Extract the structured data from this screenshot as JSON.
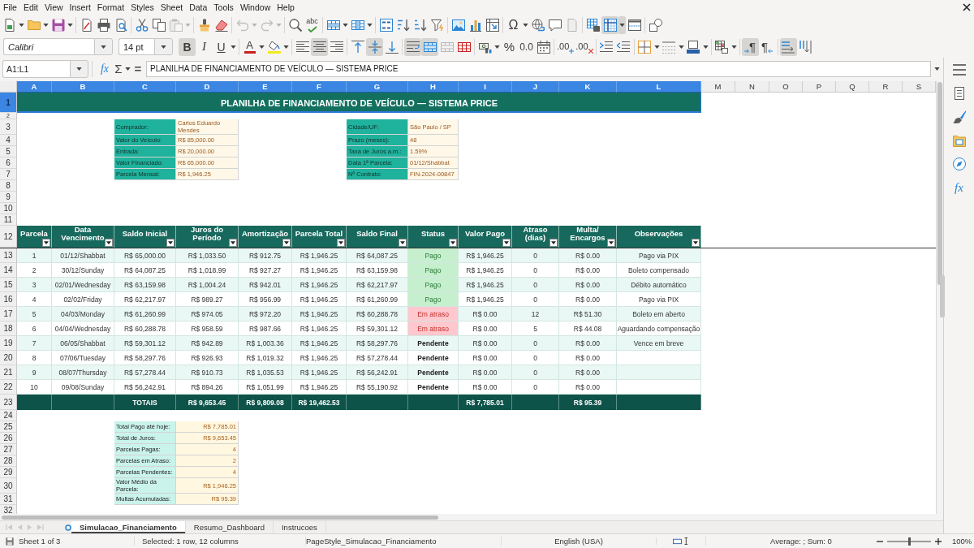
{
  "menu": [
    "File",
    "Edit",
    "View",
    "Insert",
    "Format",
    "Styles",
    "Sheet",
    "Data",
    "Tools",
    "Window",
    "Help"
  ],
  "standard_toolbar": {
    "paste_enabled": false,
    "undo_enabled": false,
    "redo_enabled": false,
    "spelling_glyph": "abc",
    "special_character_glyph": "Ω",
    "freeze_pressed": true
  },
  "formatting_toolbar": {
    "font_name": "Calibri",
    "font_size": "14 pt",
    "bold": {
      "glyph": "B",
      "pressed": true
    },
    "italic": {
      "glyph": "I",
      "pressed": false
    },
    "underline": {
      "glyph": "U",
      "pressed": false
    },
    "font_color": {
      "glyph": "A"
    },
    "align_left": {
      "pressed": false
    },
    "align_center": {
      "pressed": true
    },
    "align_right": {
      "pressed": false
    },
    "align_top": {
      "pressed": false
    },
    "align_middle": {
      "pressed": true
    },
    "align_bottom": {
      "pressed": false
    },
    "wrap_text": {
      "pressed": true
    },
    "merge_center": {
      "pressed": true
    },
    "percent": {
      "glyph": "%"
    },
    "number": {
      "glyph": "0.0"
    },
    "add_decimal": {
      "glyph": ".00"
    },
    "delete_decimal": {
      "glyph": ".00"
    },
    "ltr": {
      "glyph": "¶",
      "pressed": true
    },
    "rtl": {
      "glyph": "¶",
      "pressed": false
    },
    "text_horizontal": {
      "pressed": true
    },
    "text_vertical": {
      "pressed": false
    }
  },
  "formula_bar": {
    "cell_reference": "A1:L1",
    "function_wizard_glyph": "fx",
    "sum_glyph": "Σ",
    "equals_glyph": "=",
    "content": "PLANILHA DE FINANCIAMENTO DE VEÍCULO — SISTEMA PRICE"
  },
  "sheet": {
    "columns": [
      {
        "label": "A",
        "selected": true
      },
      {
        "label": "B",
        "selected": true
      },
      {
        "label": "C",
        "selected": true
      },
      {
        "label": "D",
        "selected": true
      },
      {
        "label": "E",
        "selected": true
      },
      {
        "label": "F",
        "selected": true
      },
      {
        "label": "G",
        "selected": true
      },
      {
        "label": "H",
        "selected": true
      },
      {
        "label": "I",
        "selected": true
      },
      {
        "label": "J",
        "selected": true
      },
      {
        "label": "K",
        "selected": true
      },
      {
        "label": "L",
        "selected": true
      },
      {
        "label": "M",
        "selected": false
      },
      {
        "label": "N",
        "selected": false
      },
      {
        "label": "O",
        "selected": false
      },
      {
        "label": "P",
        "selected": false
      },
      {
        "label": "Q",
        "selected": false
      },
      {
        "label": "R",
        "selected": false
      },
      {
        "label": "S",
        "selected": false
      }
    ],
    "rows": [
      {
        "number": "1",
        "selected": true,
        "kind": "title",
        "text": "PLANILHA DE FINANCIAMENTO DE VEÍCULO — SISTEMA PRICE"
      },
      {
        "number": "2",
        "selected": false,
        "kind": "spacer"
      },
      {
        "number": "3",
        "selected": false,
        "kind": "info",
        "left": {
          "label": "Comprador:",
          "value": "Carlos Eduardo Mendes"
        },
        "right": {
          "label": "Cidade/UF:",
          "value": "São Paulo / SP"
        }
      },
      {
        "number": "4",
        "selected": false,
        "kind": "info",
        "left": {
          "label": "Valor do Veículo:",
          "value": "R$ 85,000.00"
        },
        "right": {
          "label": "Prazo (meses):",
          "value": "48"
        }
      },
      {
        "number": "5",
        "selected": false,
        "kind": "info",
        "left": {
          "label": "Entrada:",
          "value": "R$ 20,000.00"
        },
        "right": {
          "label": "Taxa de Juros a.m.:",
          "value": "1.59%"
        }
      },
      {
        "number": "6",
        "selected": false,
        "kind": "info",
        "left": {
          "label": "Valor Financiado:",
          "value": "R$ 65,000.00"
        },
        "right": {
          "label": "Data 1ª Parcela:",
          "value": "01/12/Shabbat"
        }
      },
      {
        "number": "7",
        "selected": false,
        "kind": "info",
        "left": {
          "label": "Parcela Mensal:",
          "value": "R$ 1,946.25"
        },
        "right": {
          "label": "Nº Contrato:",
          "value": "FIN-2024-00847"
        }
      },
      {
        "number": "8",
        "selected": false,
        "kind": "blank"
      },
      {
        "number": "9",
        "selected": false,
        "kind": "blank"
      },
      {
        "number": "10",
        "selected": false,
        "kind": "blank"
      },
      {
        "number": "11",
        "selected": false,
        "kind": "blank"
      },
      {
        "number": "12",
        "selected": false,
        "kind": "header",
        "labels": [
          "Parcela",
          "Data Vencimento",
          "Saldo Inicial",
          "Juros do Período",
          "Amortização",
          "Parcela Total",
          "Saldo Final",
          "Status",
          "Valor Pago",
          "Atraso (dias)",
          "Multa/ Encargos",
          "Observações"
        ]
      },
      {
        "number": "13",
        "selected": false,
        "kind": "data",
        "cells": [
          "1",
          "01/12/Shabbat",
          "R$ 65,000.00",
          "R$ 1,033.50",
          "R$ 912.75",
          "R$ 1,946.25",
          "R$ 64,087.25",
          {
            "text": "Pago",
            "kind": "paid"
          },
          "R$ 1,946.25",
          "0",
          "R$ 0.00",
          "Pago via PIX"
        ]
      },
      {
        "number": "14",
        "selected": false,
        "kind": "data",
        "cells": [
          "2",
          "30/12/Sunday",
          "R$ 64,087.25",
          "R$ 1,018.99",
          "R$ 927.27",
          "R$ 1,946.25",
          "R$ 63,159.98",
          {
            "text": "Pago",
            "kind": "paid"
          },
          "R$ 1,946.25",
          "0",
          "R$ 0.00",
          "Boleto compensado"
        ]
      },
      {
        "number": "15",
        "selected": false,
        "kind": "data",
        "cells": [
          "3",
          "02/01/Wednesday",
          "R$ 63,159.98",
          "R$ 1,004.24",
          "R$ 942.01",
          "R$ 1,946.25",
          "R$ 62,217.97",
          {
            "text": "Pago",
            "kind": "paid"
          },
          "R$ 1,946.25",
          "0",
          "R$ 0.00",
          "Débito automático"
        ]
      },
      {
        "number": "16",
        "selected": false,
        "kind": "data",
        "cells": [
          "4",
          "02/02/Friday",
          "R$ 62,217.97",
          "R$ 989.27",
          "R$ 956.99",
          "R$ 1,946.25",
          "R$ 61,260.99",
          {
            "text": "Pago",
            "kind": "paid"
          },
          "R$ 1,946.25",
          "0",
          "R$ 0.00",
          "Pago via PIX"
        ]
      },
      {
        "number": "17",
        "selected": false,
        "kind": "data",
        "cells": [
          "5",
          "04/03/Monday",
          "R$ 61,260.99",
          "R$ 974.05",
          "R$ 972.20",
          "R$ 1,946.25",
          "R$ 60,288.78",
          {
            "text": "Em atraso",
            "kind": "late"
          },
          "R$ 0.00",
          "12",
          "R$ 51.30",
          "Boleto em aberto"
        ]
      },
      {
        "number": "18",
        "selected": false,
        "kind": "data",
        "cells": [
          "6",
          "04/04/Wednesday",
          "R$ 60,288.78",
          "R$ 958.59",
          "R$ 987.66",
          "R$ 1,946.25",
          "R$ 59,301.12",
          {
            "text": "Em atraso",
            "kind": "late"
          },
          "R$ 0.00",
          "5",
          "R$ 44.08",
          "Aguardando compensação"
        ]
      },
      {
        "number": "19",
        "selected": false,
        "kind": "data",
        "cells": [
          "7",
          "06/05/Shabbat",
          "R$ 59,301.12",
          "R$ 942.89",
          "R$ 1,003.36",
          "R$ 1,946.25",
          "R$ 58,297.76",
          {
            "text": "Pendente",
            "kind": "pending"
          },
          "R$ 0.00",
          "0",
          "R$ 0.00",
          "Vence em breve"
        ]
      },
      {
        "number": "20",
        "selected": false,
        "kind": "data",
        "cells": [
          "8",
          "07/06/Tuesday",
          "R$ 58,297.76",
          "R$ 926.93",
          "R$ 1,019.32",
          "R$ 1,946.25",
          "R$ 57,278.44",
          {
            "text": "Pendente",
            "kind": "pending"
          },
          "R$ 0.00",
          "0",
          "R$ 0.00"
        ]
      },
      {
        "number": "21",
        "selected": false,
        "kind": "data",
        "cells": [
          "9",
          "08/07/Thursday",
          "R$ 57,278.44",
          "R$ 910.73",
          "R$ 1,035.53",
          "R$ 1,946.25",
          "R$ 56,242.91",
          {
            "text": "Pendente",
            "kind": "pending"
          },
          "R$ 0.00",
          "0",
          "R$ 0.00"
        ]
      },
      {
        "number": "22",
        "selected": false,
        "kind": "data",
        "cells": [
          "10",
          "09/08/Sunday",
          "R$ 56,242.91",
          "R$ 894.26",
          "R$ 1,051.99",
          "R$ 1,946.25",
          "R$ 55,190.92",
          {
            "text": "Pendente",
            "kind": "pending"
          },
          "R$ 0.00",
          "0",
          "R$ 0.00"
        ]
      },
      {
        "number": "23",
        "selected": false,
        "kind": "totals",
        "label": "TOTAIS",
        "juros": "R$ 9,653.45",
        "amortizacao": "R$ 9,809.08",
        "parcela_total": "R$ 19,462.53",
        "valor_pago": "R$ 7,785.01",
        "multa": "R$ 95.39"
      },
      {
        "number": "24",
        "selected": false,
        "kind": "blank"
      },
      {
        "number": "25",
        "selected": false,
        "kind": "summary",
        "label": "Total Pago até hoje:",
        "value": "R$ 7,785.01"
      },
      {
        "number": "26",
        "selected": false,
        "kind": "summary",
        "label": "Total de Juros:",
        "value": "R$ 9,653.45"
      },
      {
        "number": "27",
        "selected": false,
        "kind": "summary",
        "label": "Parcelas Pagas:",
        "value": "4"
      },
      {
        "number": "28",
        "selected": false,
        "kind": "summary",
        "label": "Parcelas em Atraso:",
        "value": "2"
      },
      {
        "number": "29",
        "selected": false,
        "kind": "summary",
        "label": "Parcelas Pendentes:",
        "value": "4"
      },
      {
        "number": "30",
        "selected": false,
        "kind": "summary",
        "label": "Valor Médio da Parcela:",
        "value": "R$ 1,946.25"
      },
      {
        "number": "31",
        "selected": false,
        "kind": "summary",
        "label": "Multas Acumuladas:",
        "value": "R$ 95.39"
      },
      {
        "number": "32",
        "selected": false,
        "kind": "blank"
      }
    ]
  },
  "sheet_tabs": {
    "navigation_enabled": false,
    "tabs": [
      {
        "label": "Simulacao_Financiamento",
        "selected": true
      },
      {
        "label": "Resumo_Dashboard",
        "selected": false
      },
      {
        "label": "Instrucoes",
        "selected": false
      }
    ]
  },
  "sidebar": {
    "functions_glyph": "fx"
  },
  "status_bar": {
    "sheet_info": "Sheet 1 of 3",
    "selection": "Selected: 1 row, 12 columns",
    "page_style": "PageStyle_Simulacao_Financiamento",
    "language": "English (USA)",
    "summary": "Average: ; Sum: 0",
    "zoom": {
      "level": 0.5,
      "reading": "100%"
    }
  }
}
